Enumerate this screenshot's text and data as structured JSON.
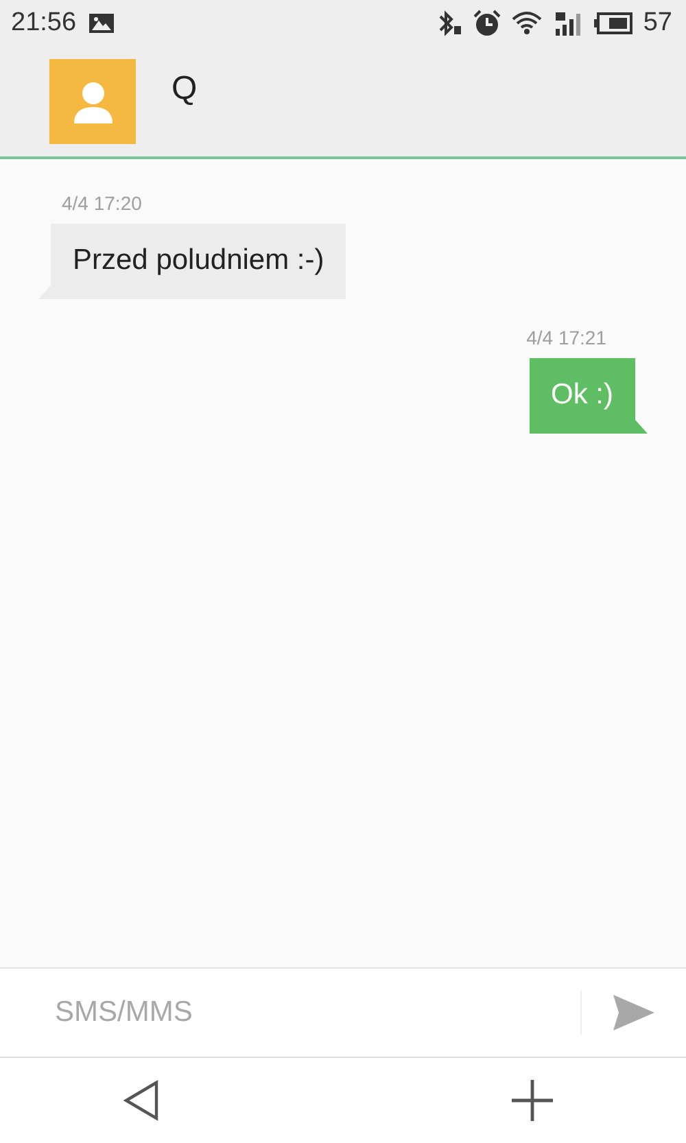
{
  "status_bar": {
    "time": "21:56",
    "battery": "57"
  },
  "header": {
    "contact_name": "Q"
  },
  "messages": [
    {
      "kind": "incoming",
      "time": "4/4 17:20",
      "text": "Przed poludniem :-)"
    },
    {
      "kind": "outgoing",
      "time": "4/4 17:21",
      "text": "Ok :)"
    }
  ],
  "composer": {
    "placeholder": "SMS/MMS"
  }
}
